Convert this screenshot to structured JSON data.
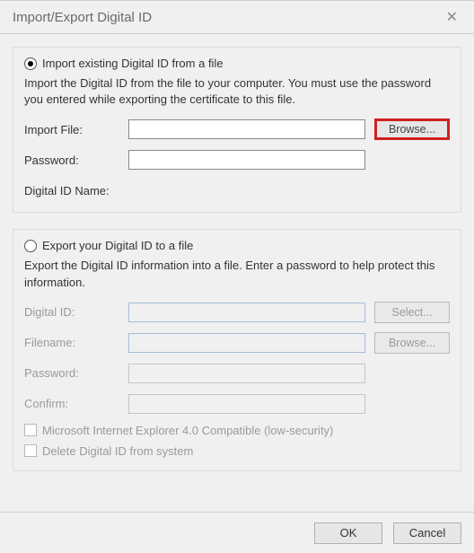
{
  "title": "Import/Export Digital ID",
  "close_glyph": "✕",
  "import": {
    "radio_label": "Import existing Digital ID from a file",
    "selected": true,
    "description": "Import the Digital ID from the file to your computer. You must use the password you entered while exporting the certificate to this file.",
    "labels": {
      "import_file": "Import File:",
      "password": "Password:",
      "digital_id_name": "Digital ID Name:"
    },
    "values": {
      "import_file": "",
      "password": "",
      "digital_id_name": ""
    },
    "browse_label": "Browse..."
  },
  "export": {
    "radio_label": "Export your Digital ID to a file",
    "selected": false,
    "description": "Export the Digital ID information into a file. Enter a password to help protect this information.",
    "labels": {
      "digital_id": "Digital ID:",
      "filename": "Filename:",
      "password": "Password:",
      "confirm": "Confirm:"
    },
    "values": {
      "digital_id": "",
      "filename": "",
      "password": "",
      "confirm": ""
    },
    "select_label": "Select...",
    "browse_label": "Browse...",
    "ie4_label": "Microsoft Internet Explorer 4.0 Compatible (low-security)",
    "delete_label": "Delete Digital ID from system"
  },
  "footer": {
    "ok": "OK",
    "cancel": "Cancel"
  }
}
